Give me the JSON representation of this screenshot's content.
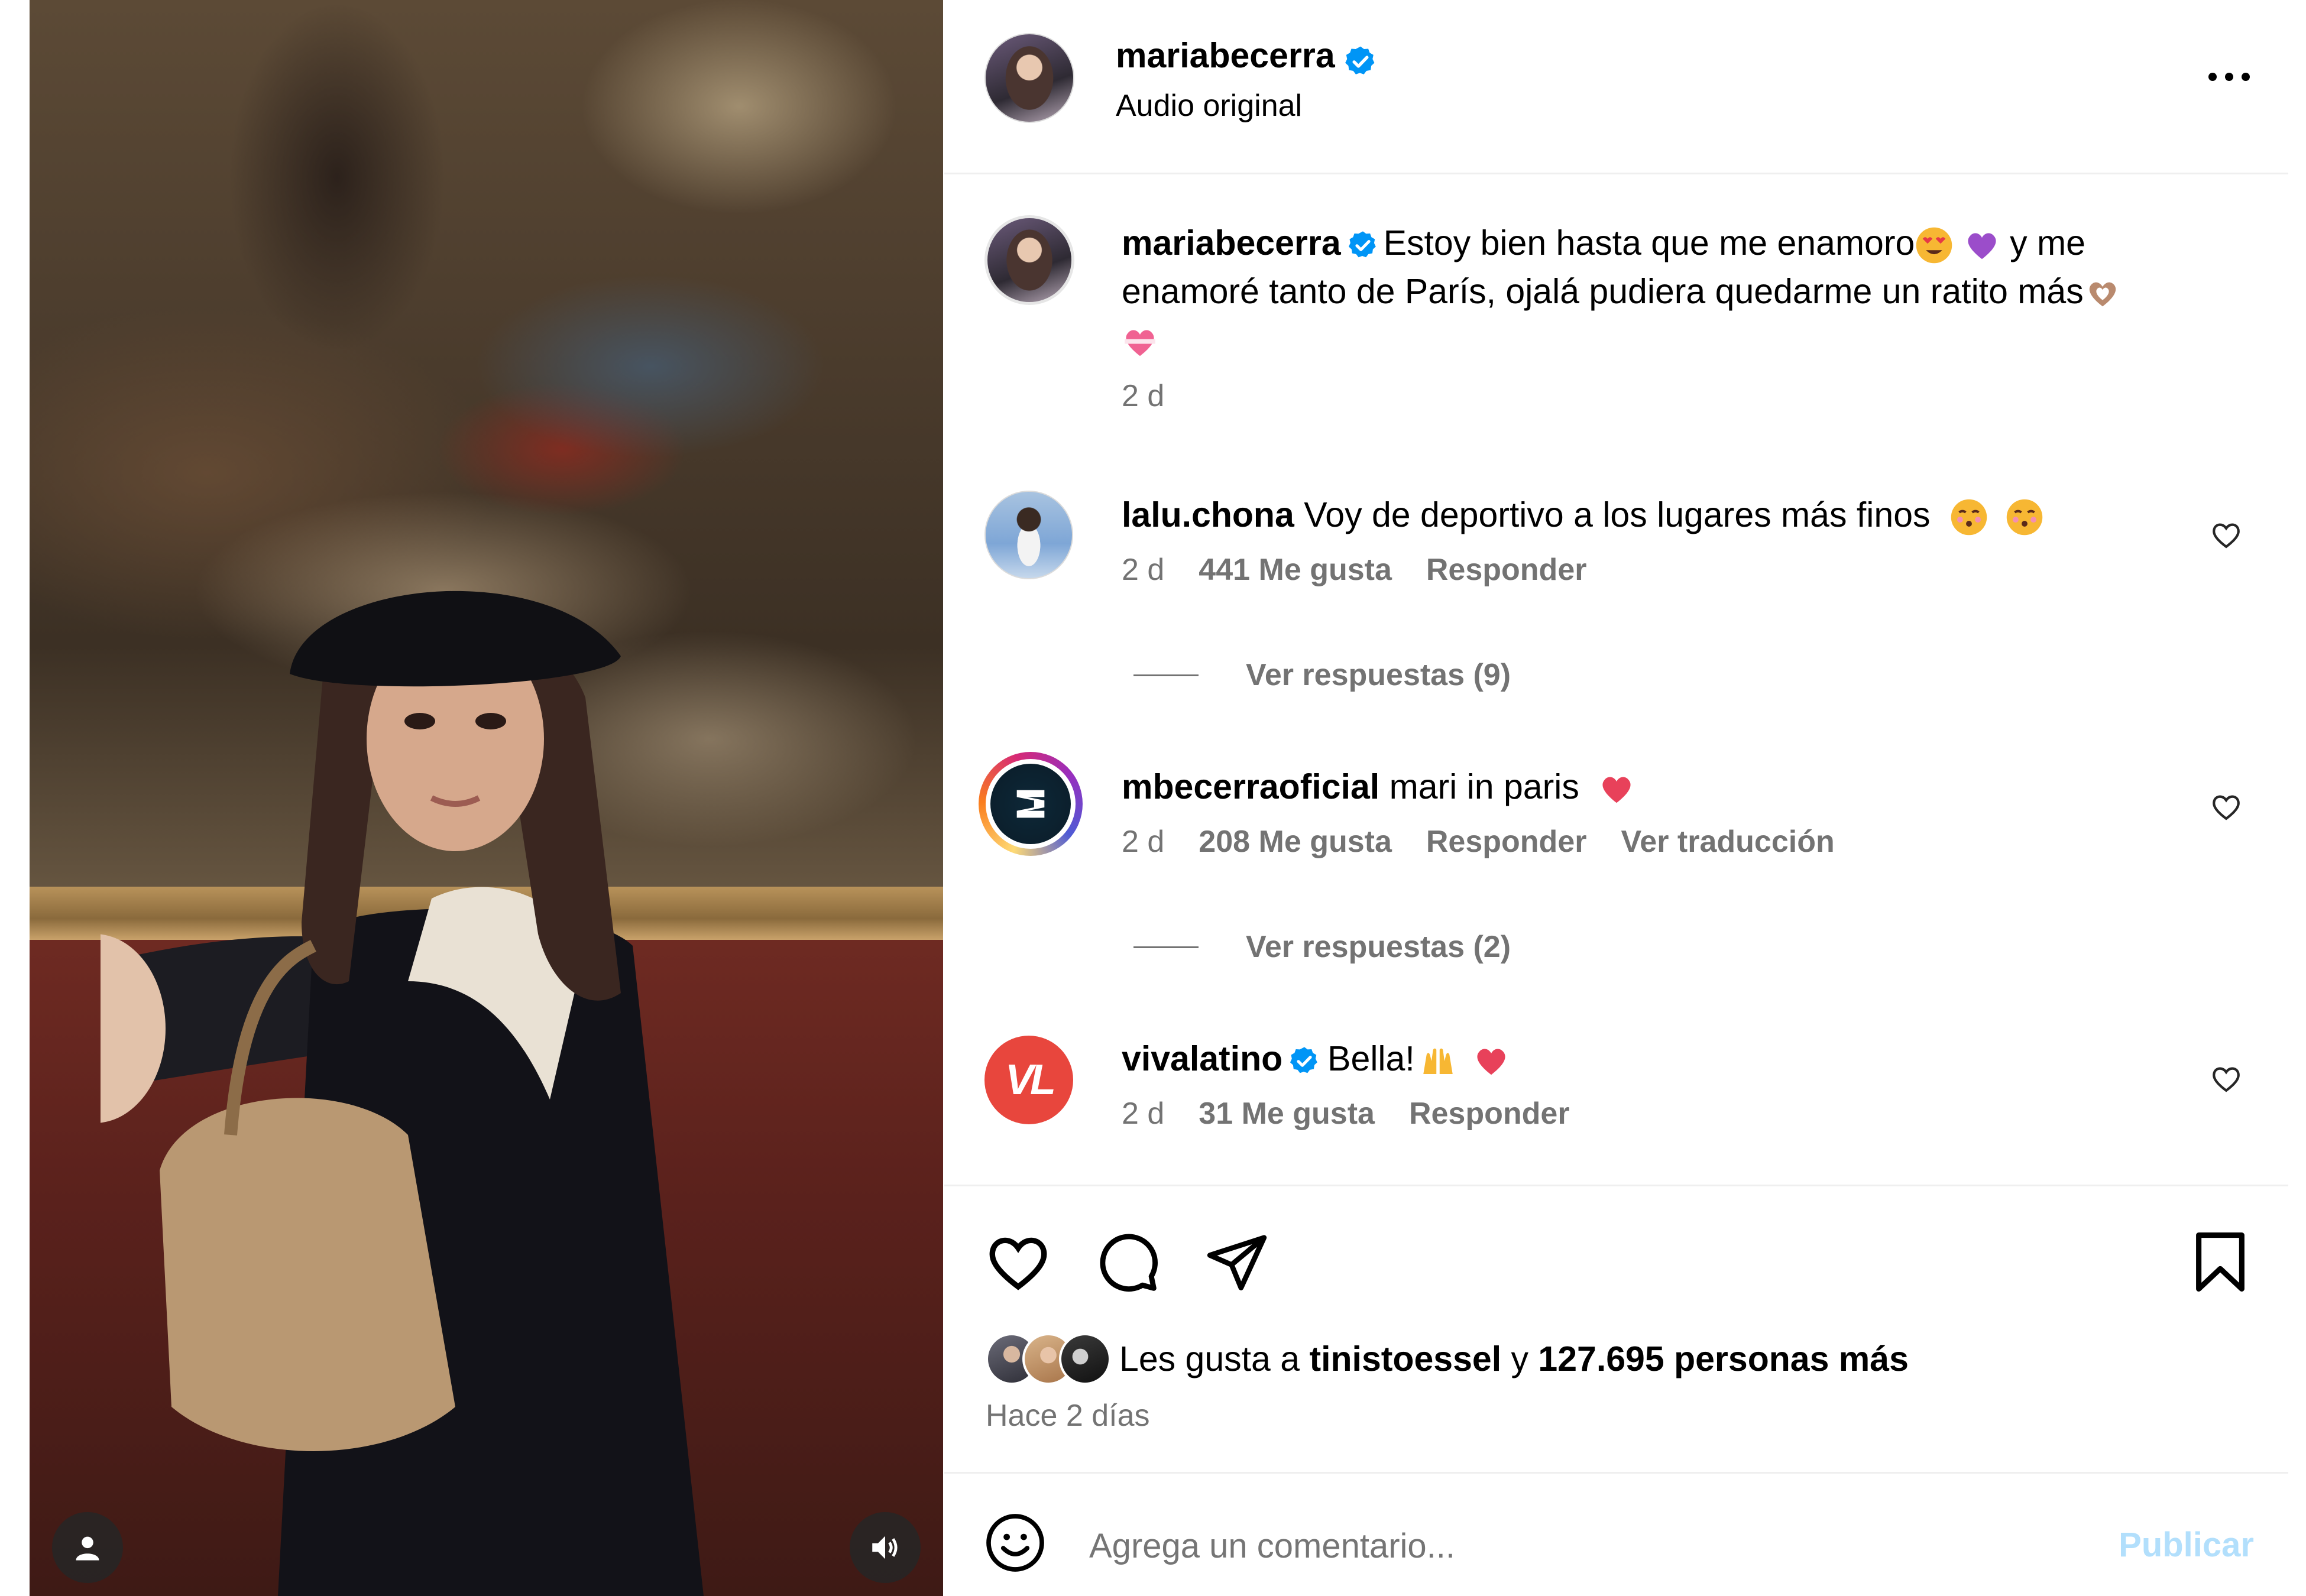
{
  "post": {
    "username": "mariabecerra",
    "audio": "Audio original",
    "caption_user": "mariabecerra",
    "caption_line1": "Estoy bien hasta que me enamoro",
    "caption_line1b": "y me",
    "caption_line2": "enamoré tanto de París, ojalá pudiera quedarme un ratito más",
    "caption_time": "2 d"
  },
  "comments": [
    {
      "user": "lalu.chona",
      "text": "Voy de deportivo a los lugares más finos",
      "time": "2 d",
      "likes": "441 Me gusta",
      "reply": "Responder",
      "view_replies": "Ver respuestas (9)"
    },
    {
      "user": "mbecerraoficial",
      "text": "mari in paris",
      "time": "2 d",
      "likes": "208 Me gusta",
      "reply": "Responder",
      "translate": "Ver traducción",
      "view_replies": "Ver respuestas (2)"
    },
    {
      "user": "vivalatino",
      "text": "Bella!",
      "time": "2 d",
      "likes": "31 Me gusta",
      "reply": "Responder",
      "avatar_text": "VL"
    }
  ],
  "likes_summary": {
    "prefix": "Les gusta a",
    "user": "tinistoessel",
    "middle": "y",
    "count": "127.695 personas más",
    "date": "Hace 2 días"
  },
  "composer": {
    "placeholder": "Agrega un comentario...",
    "publish": "Publicar"
  },
  "colors": {
    "verified": "#0095f6",
    "publish_disabled": "#b2dffc",
    "secondary_text": "#737373"
  },
  "icons": [
    "more-options-icon",
    "verified-badge-icon",
    "heart-icon",
    "comment-icon",
    "share-icon",
    "bookmark-icon",
    "emoji-icon",
    "user-tag-icon",
    "volume-icon"
  ]
}
